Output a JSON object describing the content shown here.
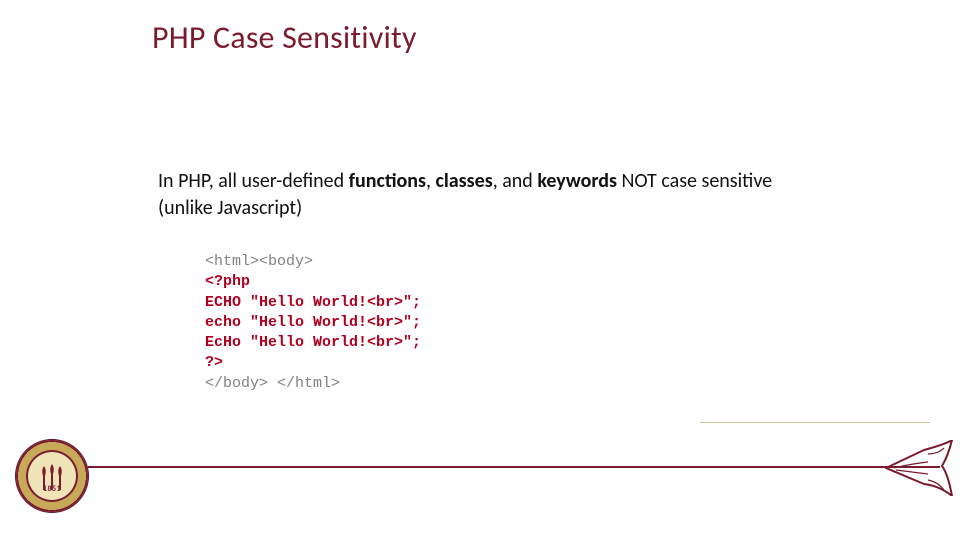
{
  "title": "PHP Case Sensitivity",
  "body": {
    "pre": "In PHP, all user-defined ",
    "b1": "functions",
    "sep1": ", ",
    "b2": "classes",
    "sep2": ", and ",
    "b3": "keywords",
    "post": " NOT case sensitive (unlike Javascript)"
  },
  "code": {
    "l1": "<html><body>",
    "l2": "<?php",
    "l3": "ECHO \"Hello World!<br>\";",
    "l4": "echo \"Hello World!<br>\";",
    "l5": "EcHo \"Hello World!<br>\";",
    "l6": "?>",
    "l7": "</body> </html>"
  },
  "seal": {
    "year": "1851"
  },
  "colors": {
    "accent": "#7a1b2e",
    "gold": "#c8a95a",
    "code_red": "#b00020",
    "code_gray": "#808080"
  }
}
